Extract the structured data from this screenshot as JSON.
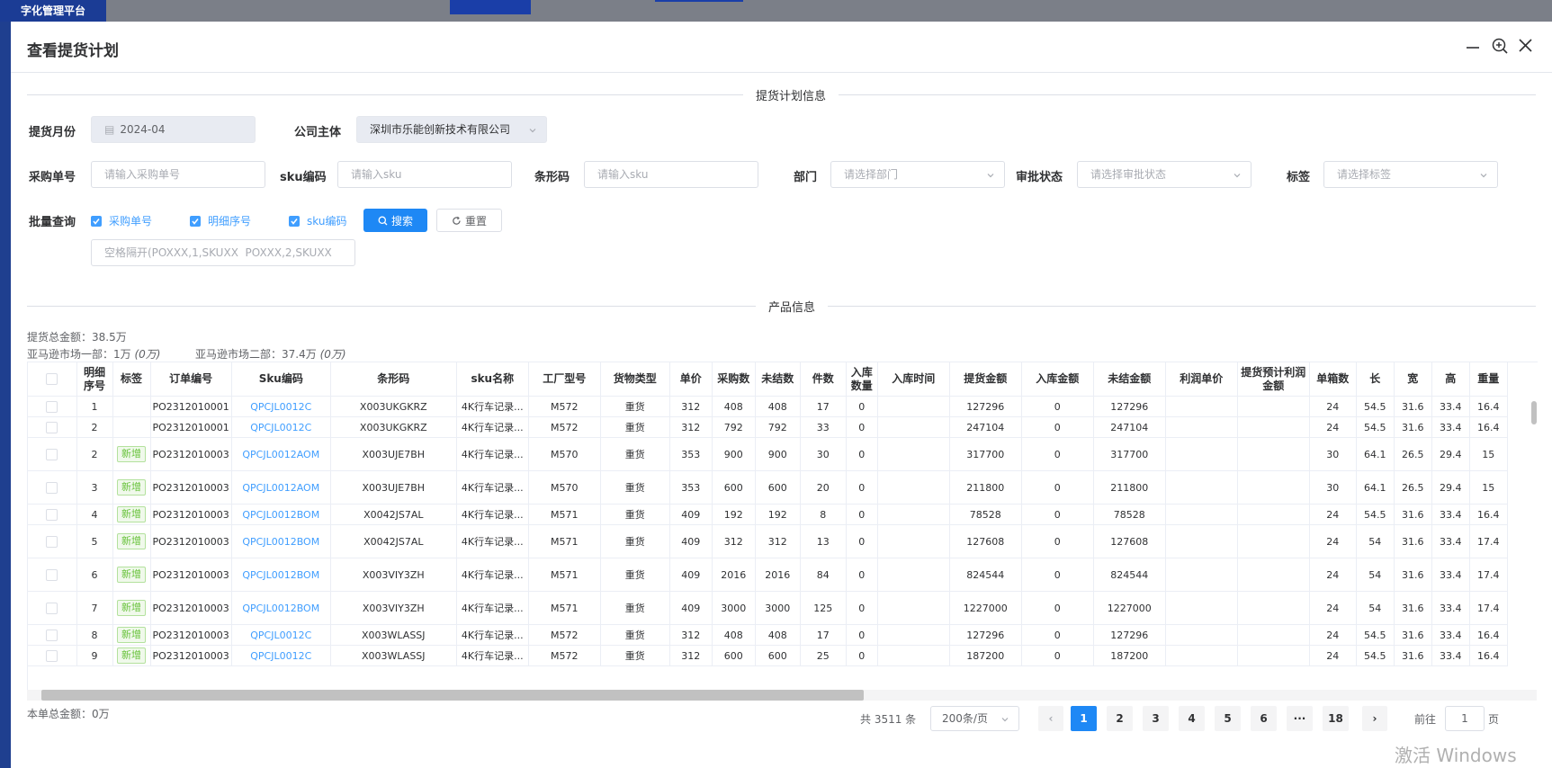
{
  "background": {
    "logo_text": "字化管理平台"
  },
  "dialog": {
    "title": "查看提货计划",
    "section_plan": "提货计划信息",
    "section_product": "产品信息"
  },
  "form": {
    "month_label": "提货月份",
    "month_value": "2024-04",
    "company_label": "公司主体",
    "company_value": "深圳市乐能创新技术有限公司",
    "po_label": "采购单号",
    "po_placeholder": "请输入采购单号",
    "sku_label": "sku编码",
    "sku_placeholder": "请输入sku",
    "barcode_label": "条形码",
    "barcode_placeholder": "请输入sku",
    "dept_label": "部门",
    "dept_placeholder": "请选择部门",
    "approval_label": "审批状态",
    "approval_placeholder": "请选择审批状态",
    "tag_label": "标签",
    "tag_placeholder": "请选择标签",
    "batch_label": "批量查询",
    "chk_po": "采购单号",
    "chk_detail": "明细序号",
    "chk_sku": "sku编码",
    "search_button": "搜索",
    "reset_button": "重置",
    "batch_placeholder": "空格隔开(POXXX,1,SKUXX  POXXX,2,SKUXX"
  },
  "stats": {
    "total": "提货总金额：38.5万",
    "dept1_label": "亚马逊市场一部：1万",
    "dept1_paren": "(0万)",
    "dept2_label": "亚马逊市场二部：37.4万",
    "dept2_paren": "(0万)"
  },
  "table": {
    "headers": [
      "",
      "明细序号",
      "标签",
      "订单编号",
      "Sku编码",
      "条形码",
      "sku名称",
      "工厂型号",
      "货物类型",
      "单价",
      "采购数",
      "未结数",
      "件数",
      "入库数量",
      "入库时间",
      "提货金额",
      "入库金额",
      "未结金额",
      "利润单价",
      "提货预计利润金额",
      "单箱数",
      "长",
      "宽",
      "高",
      "重量"
    ],
    "rows": [
      [
        "1",
        "",
        "PO2312010001",
        "QPCJL0012C",
        "X003UKGKRZ",
        "4K行车记录...",
        "M572",
        "重货",
        "312",
        "408",
        "408",
        "17",
        "0",
        "",
        "127296",
        "0",
        "127296",
        "",
        "",
        "24",
        "54.5",
        "31.6",
        "33.4",
        "16.4"
      ],
      [
        "2",
        "",
        "PO2312010001",
        "QPCJL0012C",
        "X003UKGKRZ",
        "4K行车记录...",
        "M572",
        "重货",
        "312",
        "792",
        "792",
        "33",
        "0",
        "",
        "247104",
        "0",
        "247104",
        "",
        "",
        "24",
        "54.5",
        "31.6",
        "33.4",
        "16.4"
      ],
      [
        "2",
        "新增",
        "PO2312010003",
        "QPCJL0012AOM",
        "X003UJE7BH",
        "4K行车记录...",
        "M570",
        "重货",
        "353",
        "900",
        "900",
        "30",
        "0",
        "",
        "317700",
        "0",
        "317700",
        "",
        "",
        "30",
        "64.1",
        "26.5",
        "29.4",
        "15"
      ],
      [
        "3",
        "新增",
        "PO2312010003",
        "QPCJL0012AOM",
        "X003UJE7BH",
        "4K行车记录...",
        "M570",
        "重货",
        "353",
        "600",
        "600",
        "20",
        "0",
        "",
        "211800",
        "0",
        "211800",
        "",
        "",
        "30",
        "64.1",
        "26.5",
        "29.4",
        "15"
      ],
      [
        "4",
        "新增",
        "PO2312010003",
        "QPCJL0012BOM",
        "X0042JS7AL",
        "4K行车记录...",
        "M571",
        "重货",
        "409",
        "192",
        "192",
        "8",
        "0",
        "",
        "78528",
        "0",
        "78528",
        "",
        "",
        "24",
        "54.5",
        "31.6",
        "33.4",
        "16.4"
      ],
      [
        "5",
        "新增",
        "PO2312010003",
        "QPCJL0012BOM",
        "X0042JS7AL",
        "4K行车记录...",
        "M571",
        "重货",
        "409",
        "312",
        "312",
        "13",
        "0",
        "",
        "127608",
        "0",
        "127608",
        "",
        "",
        "24",
        "54",
        "31.6",
        "33.4",
        "17.4"
      ],
      [
        "6",
        "新增",
        "PO2312010003",
        "QPCJL0012BOM",
        "X003VIY3ZH",
        "4K行车记录...",
        "M571",
        "重货",
        "409",
        "2016",
        "2016",
        "84",
        "0",
        "",
        "824544",
        "0",
        "824544",
        "",
        "",
        "24",
        "54",
        "31.6",
        "33.4",
        "17.4"
      ],
      [
        "7",
        "新增",
        "PO2312010003",
        "QPCJL0012BOM",
        "X003VIY3ZH",
        "4K行车记录...",
        "M571",
        "重货",
        "409",
        "3000",
        "3000",
        "125",
        "0",
        "",
        "1227000",
        "0",
        "1227000",
        "",
        "",
        "24",
        "54",
        "31.6",
        "33.4",
        "17.4"
      ],
      [
        "8",
        "新增",
        "PO2312010003",
        "QPCJL0012C",
        "X003WLASSJ",
        "4K行车记录...",
        "M572",
        "重货",
        "312",
        "408",
        "408",
        "17",
        "0",
        "",
        "127296",
        "0",
        "127296",
        "",
        "",
        "24",
        "54.5",
        "31.6",
        "33.4",
        "16.4"
      ],
      [
        "9",
        "新增",
        "PO2312010003",
        "QPCJL0012C",
        "X003WLASSJ",
        "4K行车记录...",
        "M572",
        "重货",
        "312",
        "600",
        "600",
        "25",
        "0",
        "",
        "187200",
        "0",
        "187200",
        "",
        "",
        "24",
        "54.5",
        "31.6",
        "33.4",
        "16.4"
      ]
    ]
  },
  "footer": {
    "order_total": "本单总金额：0万"
  },
  "pagination": {
    "total": "共 3511 条",
    "page_size": "200条/页",
    "pages": [
      "1",
      "2",
      "3",
      "4",
      "5",
      "6",
      "···",
      "18"
    ],
    "current": "1",
    "goto_label": "前往",
    "goto_value": "1",
    "page_suffix": "页"
  },
  "watermark": "激活 Windows"
}
